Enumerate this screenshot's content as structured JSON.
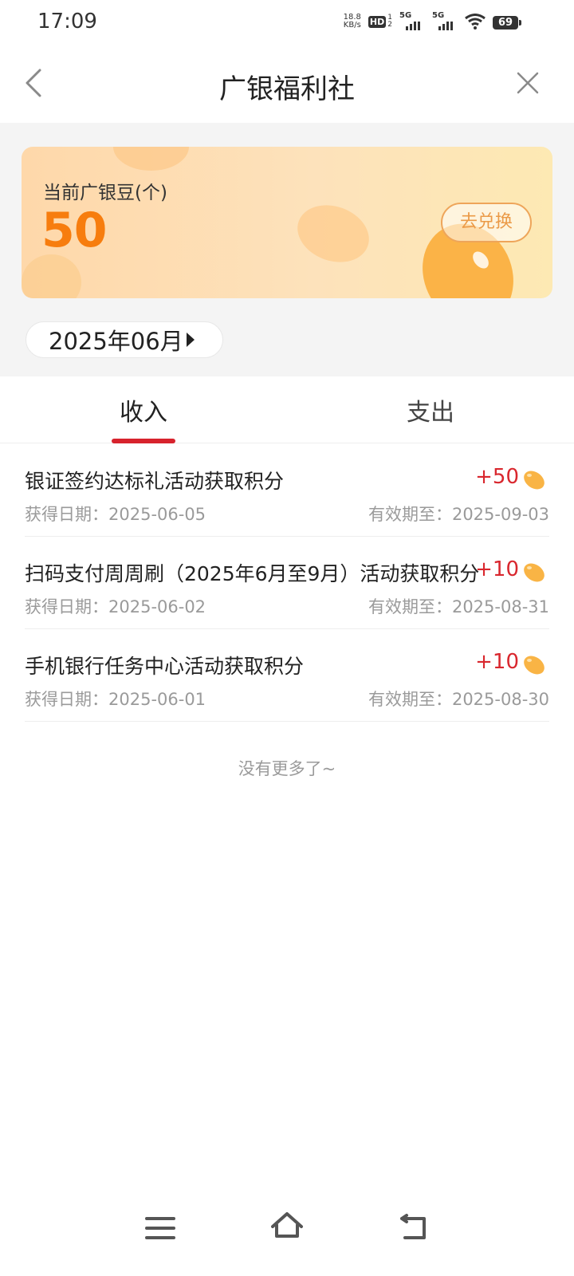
{
  "status_bar": {
    "time": "17:09",
    "net_speed_value": "18.8",
    "net_speed_unit": "KB/s",
    "hd_label": "HD",
    "sim1_label": "5G",
    "sim2_label": "5G",
    "battery": "69",
    "icons": [
      "hd-icon",
      "signal-icon",
      "signal-icon",
      "wifi-icon",
      "battery-icon"
    ]
  },
  "header": {
    "title": "广银福利社",
    "back_icon": "chevron-left-icon",
    "close_icon": "close-icon"
  },
  "balance_card": {
    "label": "当前广银豆(个)",
    "value": "50",
    "exchange_label": "去兑换",
    "accent_color": "#f77d0e"
  },
  "month_filter": {
    "label": "2025年06月"
  },
  "tabs": {
    "income": "收入",
    "expense": "支出",
    "active": "income",
    "indicator_color": "#d7232d"
  },
  "records": [
    {
      "title": "银证签约达标礼活动获取积分",
      "points": "+50",
      "date": "获得日期：2025-06-05",
      "expiry": "有效期至：2025-09-03"
    },
    {
      "title": "扫码支付周周刷（2025年6月至9月）活动获取积分",
      "points": "+10",
      "date": "获得日期：2025-06-02",
      "expiry": "有效期至：2025-08-31"
    },
    {
      "title": "手机银行任务中心活动获取积分",
      "points": "+10",
      "date": "获得日期：2025-06-01",
      "expiry": "有效期至：2025-08-30"
    }
  ],
  "footer_text": "没有更多了~",
  "nav_bar": {
    "icons": [
      "menu-icon",
      "home-icon",
      "back-icon"
    ]
  }
}
